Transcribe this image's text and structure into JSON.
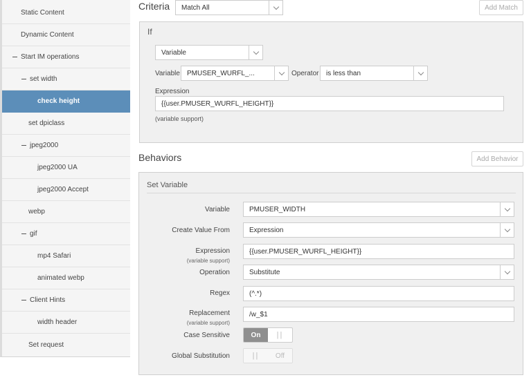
{
  "sidebar": {
    "items": [
      {
        "label": "Static Content"
      },
      {
        "label": "Dynamic Content"
      },
      {
        "label": "Start IM operations"
      },
      {
        "label": "set width"
      },
      {
        "label": "check height"
      },
      {
        "label": "set dpiclass"
      },
      {
        "label": "jpeg2000"
      },
      {
        "label": "jpeg2000 UA"
      },
      {
        "label": "jpeg2000 Accept"
      },
      {
        "label": "webp"
      },
      {
        "label": "gif"
      },
      {
        "label": "mp4 Safari"
      },
      {
        "label": "animated webp"
      },
      {
        "label": "Client Hints"
      },
      {
        "label": "width header"
      },
      {
        "label": "Set request"
      }
    ],
    "selected_label": "check height",
    "selected_color": "#5c8eb9"
  },
  "criteria": {
    "title": "Criteria",
    "match_value": "Match All",
    "add_match_label": "Add Match",
    "if_box": {
      "title": "If",
      "type_value": "Variable",
      "variable_label": "Variable",
      "variable_value": "PMUSER_WURFL_...",
      "operator_label": "Operator",
      "operator_value": "is less than",
      "expression_label": "Expression",
      "expression_value": "{{user.PMUSER_WURFL_HEIGHT}}",
      "variable_support": "(variable support)"
    }
  },
  "behaviors": {
    "title": "Behaviors",
    "add_behavior_label": "Add Behavior",
    "set_variable": {
      "title": "Set Variable",
      "variable_label": "Variable",
      "variable_value": "PMUSER_WIDTH",
      "create_value_label": "Create Value From",
      "create_value_value": "Expression",
      "expression_label": "Expression",
      "expression_sub": "(variable support)",
      "expression_value": "{{user.PMUSER_WURFL_HEIGHT}}",
      "operation_label": "Operation",
      "operation_value": "Substitute",
      "regex_label": "Regex",
      "regex_value": "(^.*)",
      "replacement_label": "Replacement",
      "replacement_sub": "(variable support)",
      "replacement_value": "/w_$1",
      "case_sensitive_label": "Case Sensitive",
      "case_sensitive_on": "On",
      "case_sensitive_grip": "||",
      "global_sub_label": "Global Substitution",
      "global_sub_grip": "||",
      "global_sub_off": "Off"
    }
  }
}
